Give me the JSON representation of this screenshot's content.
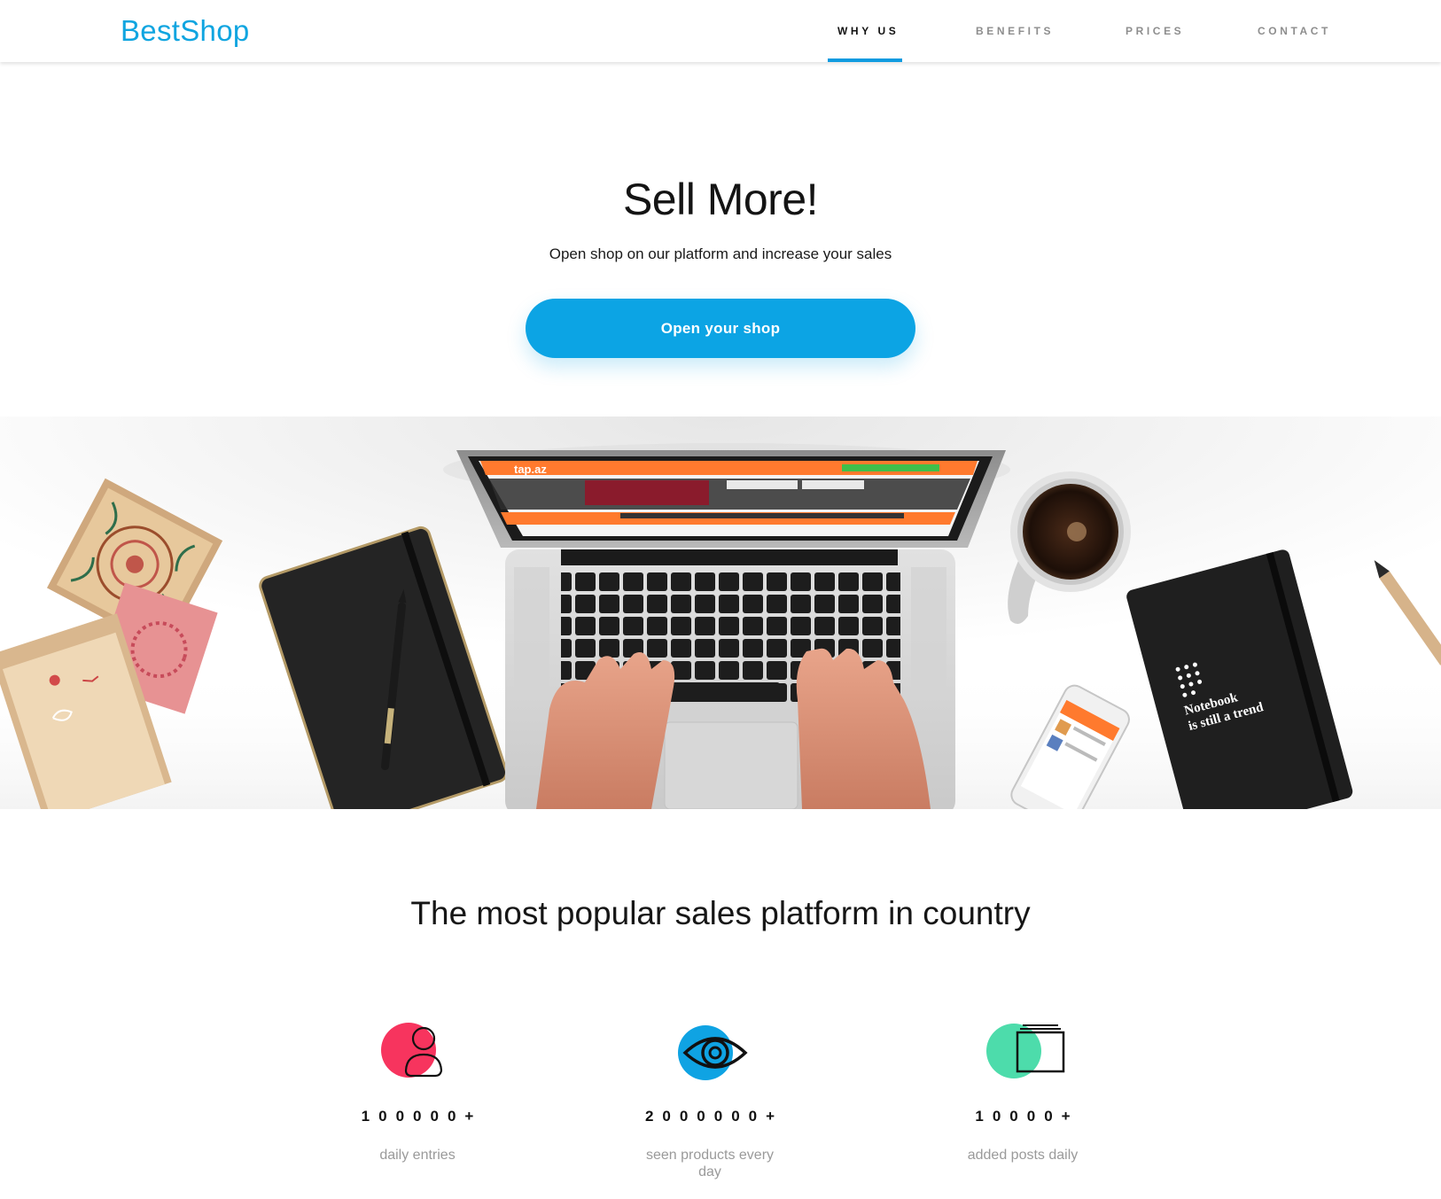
{
  "header": {
    "logo": "BestShop",
    "nav": [
      {
        "label": "WHY US",
        "active": true
      },
      {
        "label": "BENEFITS",
        "active": false
      },
      {
        "label": "PRICES",
        "active": false
      },
      {
        "label": "CONTACT",
        "active": false
      }
    ]
  },
  "hero": {
    "title": "Sell More!",
    "subtitle": "Open shop on our platform and increase your sales",
    "cta_label": "Open your shop"
  },
  "desk_image": {
    "notebook_text_line1": "Notebook",
    "notebook_text_line2": "is still a trend",
    "screen_brand": "tap.az"
  },
  "stats_section": {
    "title": "The most popular sales platform in country",
    "items": [
      {
        "icon": "user-icon",
        "accent": "#f7345e",
        "value": "100000+",
        "label": "daily entries"
      },
      {
        "icon": "eye-icon",
        "accent": "#0fa3e3",
        "value": "2000000+",
        "label": "seen products every day"
      },
      {
        "icon": "cards-icon",
        "accent": "#4ddcab",
        "value": "10000+",
        "label": "added posts daily"
      }
    ]
  },
  "colors": {
    "brand_blue": "#10a5e0",
    "button_blue": "#0ca4e4",
    "pink": "#f7345e",
    "green": "#4ddcab",
    "screen_orange": "#ff7a2e"
  }
}
